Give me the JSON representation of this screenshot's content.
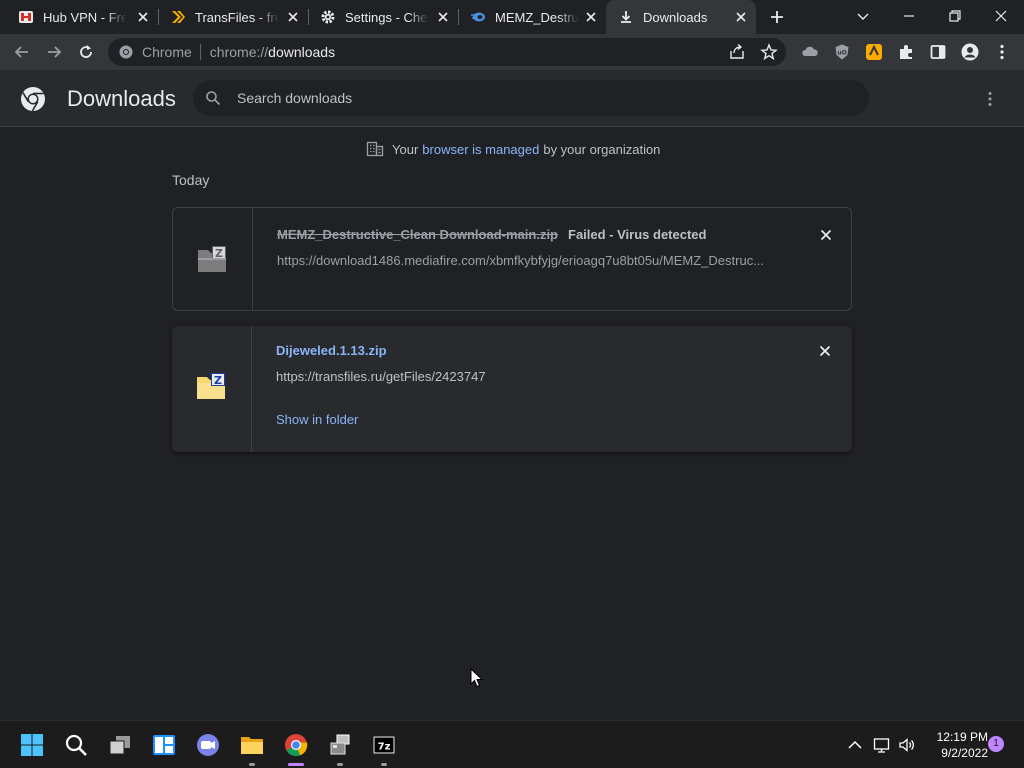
{
  "tabs": [
    {
      "title": "Hub VPN - Free",
      "icon": "hubvpn-icon"
    },
    {
      "title": "TransFiles - free",
      "icon": "transfiles-icon"
    },
    {
      "title": "Settings - Check",
      "icon": "gear-icon"
    },
    {
      "title": "MEMZ_Destruct",
      "icon": "mediafire-icon"
    },
    {
      "title": "Downloads",
      "icon": "download-icon",
      "active": true
    }
  ],
  "omnibox": {
    "chip": "Chrome",
    "url_scheme": "chrome://",
    "url_host": "downloads"
  },
  "header": {
    "title": "Downloads",
    "search_placeholder": "Search downloads"
  },
  "managed": {
    "before": "Your",
    "link": "browser is managed",
    "after": "by your organization"
  },
  "section": "Today",
  "downloads": [
    {
      "filename": "MEMZ_Destructive_Clean Download-main.zip",
      "status": "Failed - Virus detected",
      "url": "https://download1486.mediafire.com/xbmfkybfyjg/erioagq7u8bt05u/MEMZ_Destruc..."
    },
    {
      "filename": "Dijeweled.1.13.zip",
      "url": "https://transfiles.ru/getFiles/2423747",
      "action": "Show in folder"
    }
  ],
  "taskbar": {
    "time": "12:19 PM",
    "date": "9/2/2022",
    "notifications": "1"
  },
  "colors": {
    "accent": "#8ab4f8",
    "background": "#202124",
    "surface": "#292a2d",
    "toolbar": "#35363a"
  }
}
